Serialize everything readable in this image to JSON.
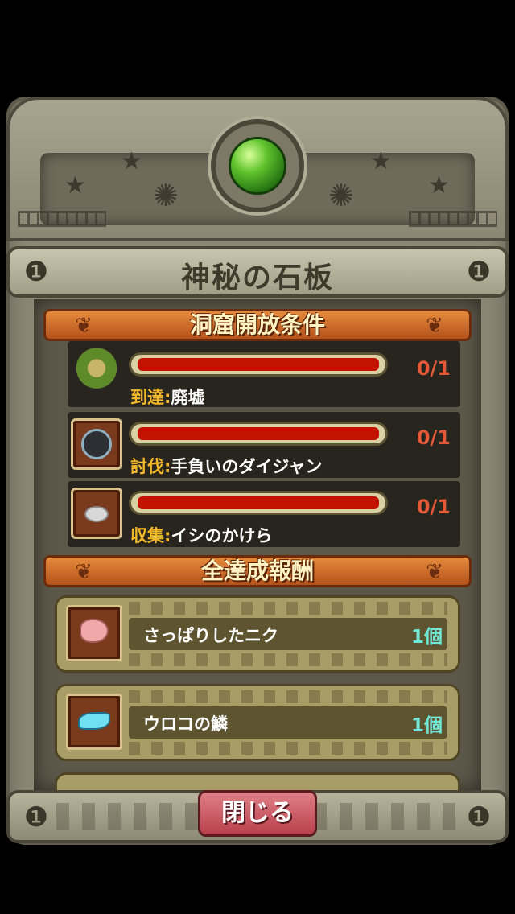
{
  "title": "神秘の石板",
  "conditions_header": "洞窟開放条件",
  "conditions": [
    {
      "kind": "到達",
      "sep": ":",
      "target": "廃墟",
      "progress_text": "0/1",
      "progress_fraction": 0.0,
      "icon": "ruins-icon"
    },
    {
      "kind": "討伐",
      "sep": ":",
      "target": "手負いのダイジャン",
      "progress_text": "0/1",
      "progress_fraction": 0.0,
      "icon": "snake-monster-icon"
    },
    {
      "kind": "収集",
      "sep": ":",
      "target": "イシのかけら",
      "progress_text": "0/1",
      "progress_fraction": 0.0,
      "icon": "stone-fragment-icon"
    }
  ],
  "rewards_header": "全達成報酬",
  "rewards": [
    {
      "name": "さっぱりしたニク",
      "qty": "1個",
      "icon": "meat-icon"
    },
    {
      "name": "ウロコの鱗",
      "qty": "1個",
      "icon": "scale-icon"
    }
  ],
  "close_label": "閉じる",
  "colors": {
    "bar_fill": "#c41200",
    "count": "#e25a3a",
    "kind": "#f3b82a",
    "qty": "#6fe8d8",
    "banner": "#d26b2a",
    "gem": "#5fc22c"
  }
}
